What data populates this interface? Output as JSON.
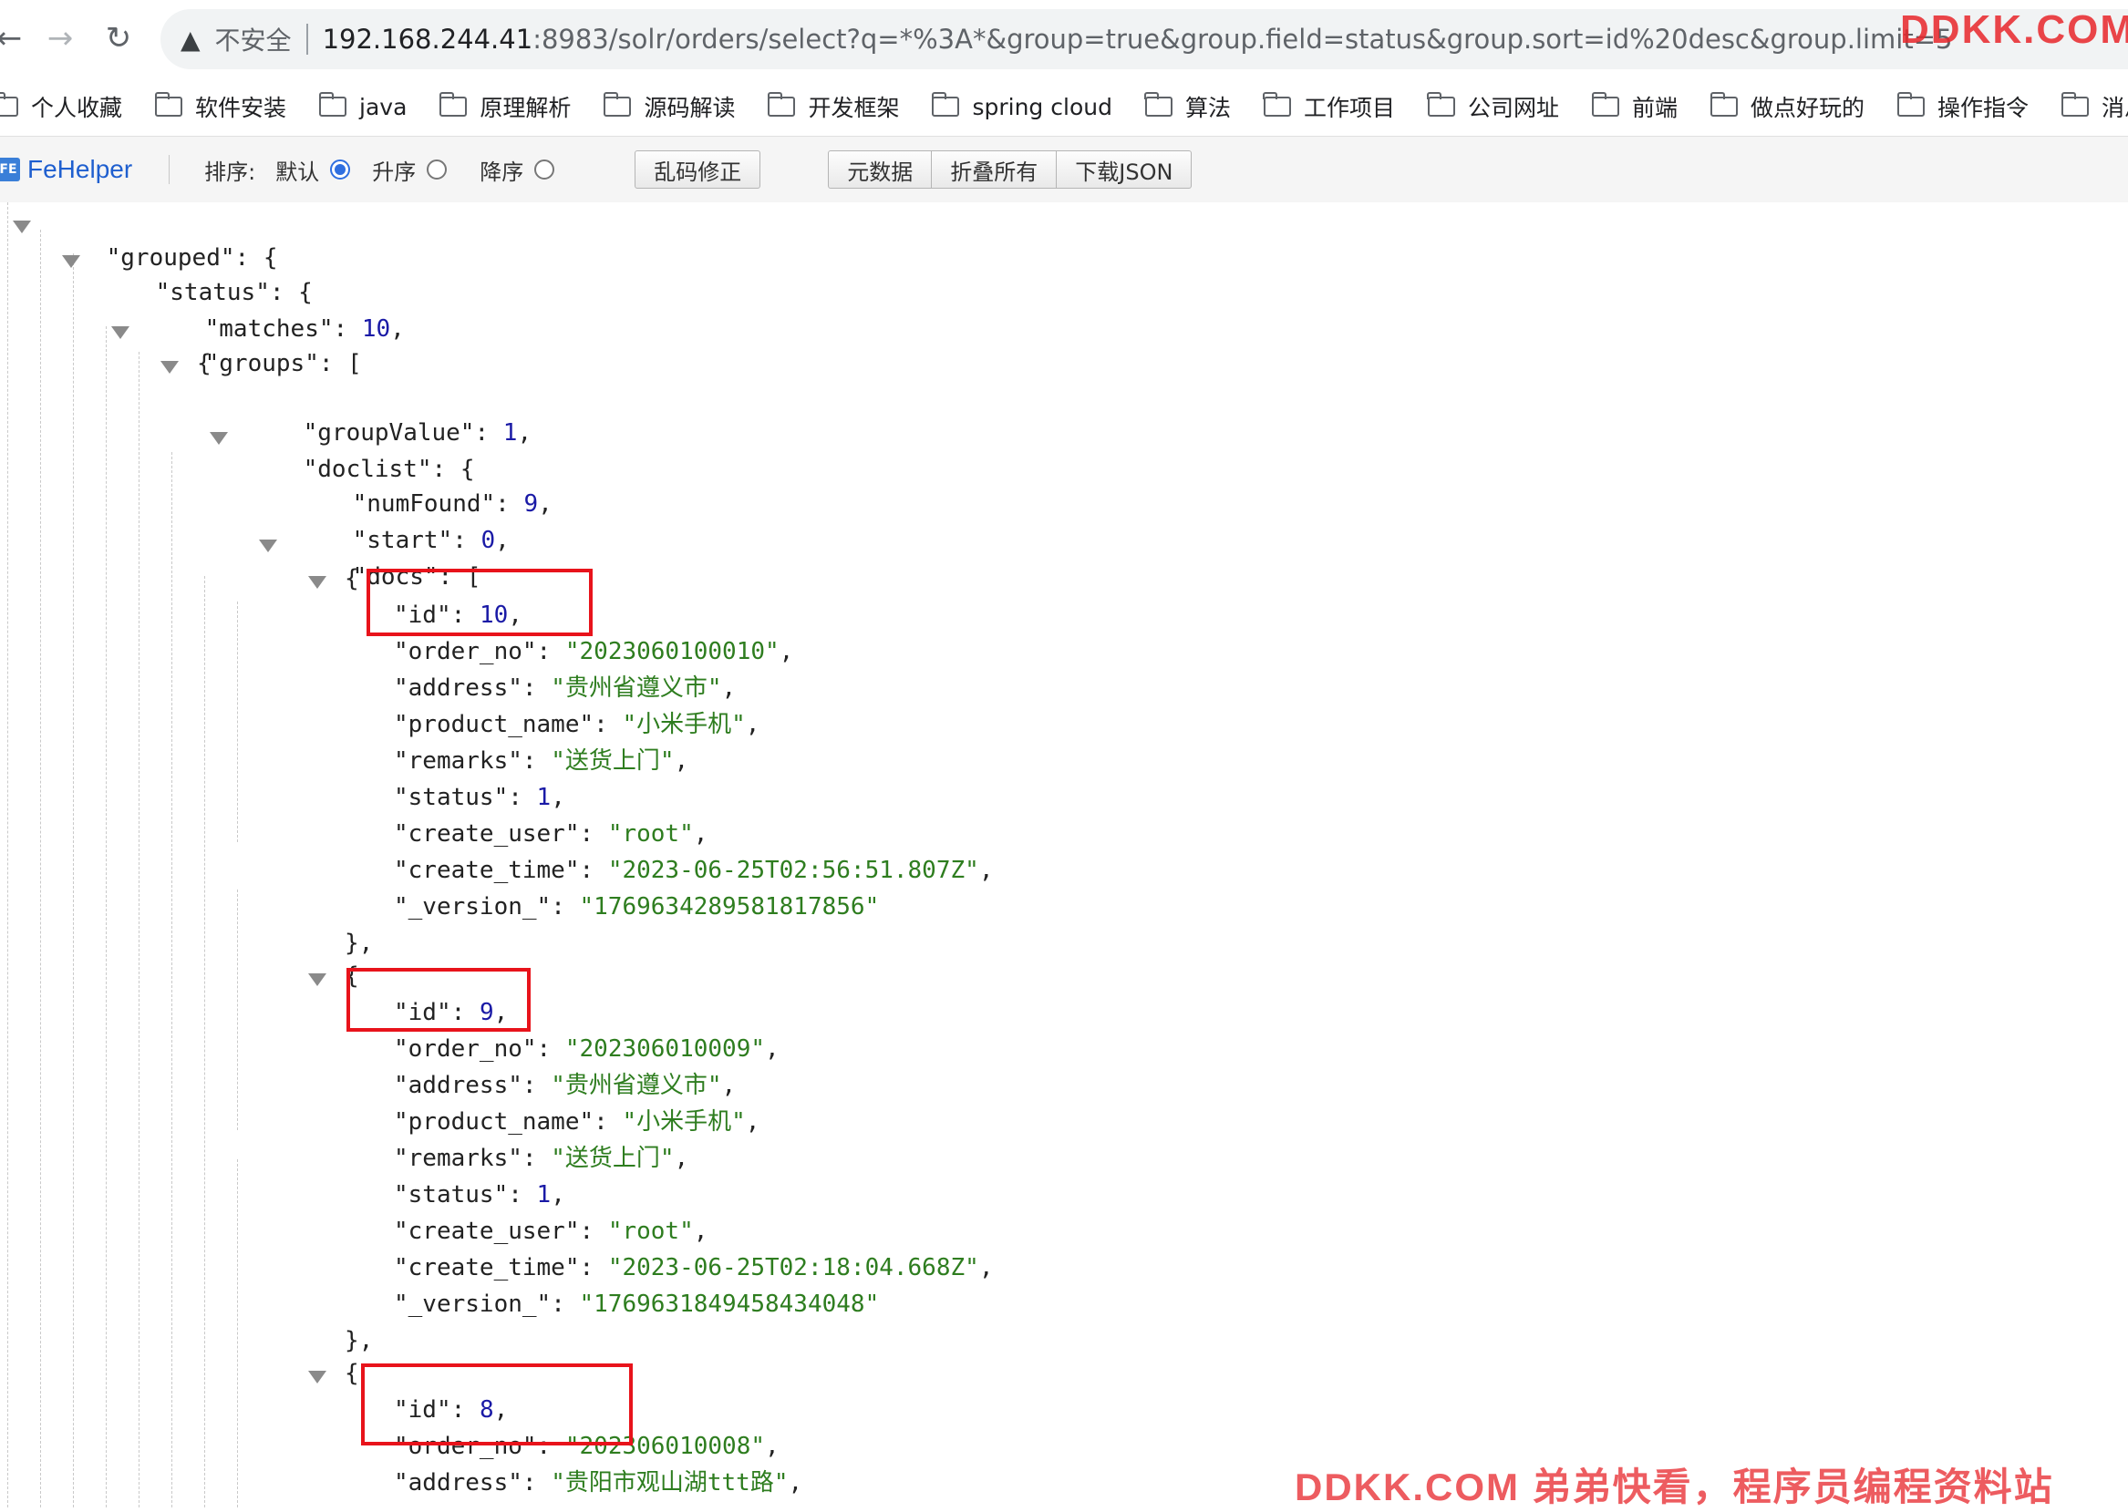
{
  "browser": {
    "insecure_label": "不安全",
    "url_host": "192.168.244.41",
    "url_rest": ":8983/solr/orders/select?q=*%3A*&group=true&group.field=status&group.sort=id%20desc&group.limit=5",
    "watermark_top": "DDKK.COM"
  },
  "bookmarks": [
    "个人收藏",
    "软件安装",
    "java",
    "原理解析",
    "源码解读",
    "开发框架",
    "spring cloud",
    "算法",
    "工作项目",
    "公司网址",
    "前端",
    "做点好玩的",
    "操作指令",
    "消息中间"
  ],
  "fehelper": {
    "logo": "FE",
    "brand": "FeHelper",
    "sort_label": "排序:",
    "sort_options": [
      {
        "label": "默认",
        "checked": true
      },
      {
        "label": "升序",
        "checked": false
      },
      {
        "label": "降序",
        "checked": false
      }
    ],
    "fix_encoding": "乱码修正",
    "buttons": [
      "元数据",
      "折叠所有",
      "下载JSON"
    ]
  },
  "json": {
    "k_grouped": "\"grouped\"",
    "k_status_obj": "\"status\"",
    "k_matches": "\"matches\"",
    "v_matches": "10",
    "k_groups": "\"groups\"",
    "k_groupValue": "\"groupValue\"",
    "v_groupValue": "1",
    "k_doclist": "\"doclist\"",
    "k_numFound": "\"numFound\"",
    "v_numFound": "9",
    "k_start": "\"start\"",
    "v_start": "0",
    "k_docs": "\"docs\"",
    "docs": [
      {
        "id": "10",
        "order_no": "\"2023060100010\"",
        "address": "\"贵州省遵义市\"",
        "product_name": "\"小米手机\"",
        "remarks": "\"送货上门\"",
        "status": "1",
        "create_user": "\"root\"",
        "create_time": "\"2023-06-25T02:56:51.807Z\"",
        "_version_": "\"1769634289581817856\""
      },
      {
        "id": "9",
        "order_no": "\"202306010009\"",
        "address": "\"贵州省遵义市\"",
        "product_name": "\"小米手机\"",
        "remarks": "\"送货上门\"",
        "status": "1",
        "create_user": "\"root\"",
        "create_time": "\"2023-06-25T02:18:04.668Z\"",
        "_version_": "\"1769631849458434048\""
      },
      {
        "id": "8",
        "order_no": "\"202306010008\"",
        "address": "\"贵阳市观山湖ttt路\""
      }
    ],
    "keys": {
      "id": "\"id\"",
      "order_no": "\"order_no\"",
      "address": "\"address\"",
      "product_name": "\"product_name\"",
      "remarks": "\"remarks\"",
      "status": "\"status\"",
      "create_user": "\"create_user\"",
      "create_time": "\"create_time\"",
      "_version_": "\"_version_\""
    }
  },
  "watermark_bottom": "DDKK.COM 弟弟快看，程序员编程资料站"
}
